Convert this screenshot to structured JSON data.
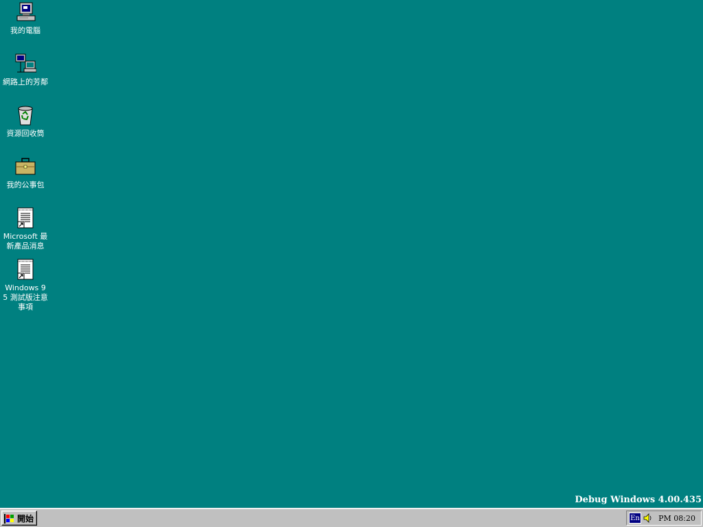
{
  "desktop": {
    "background": "#008080",
    "icons": [
      {
        "name": "my-computer",
        "label": "我的電腦",
        "icon": "computer-icon"
      },
      {
        "name": "network-neighborhood",
        "label": "網路上的芳鄰",
        "icon": "network-icon"
      },
      {
        "name": "recycle-bin",
        "label": "資源回收筒",
        "icon": "recycle-bin-icon"
      },
      {
        "name": "my-briefcase",
        "label": "我的公事包",
        "icon": "briefcase-icon"
      },
      {
        "name": "microsoft-news",
        "label": "Microsoft 最新產品消息",
        "icon": "document-shortcut-icon"
      },
      {
        "name": "windows95-notes",
        "label": "Windows 95 測試版注意事項",
        "icon": "document-shortcut-icon"
      }
    ]
  },
  "watermark": {
    "text": "Debug Windows 4.00.435"
  },
  "taskbar": {
    "start_label": "開始",
    "ime_label": "En",
    "clock": "PM 08:20"
  }
}
